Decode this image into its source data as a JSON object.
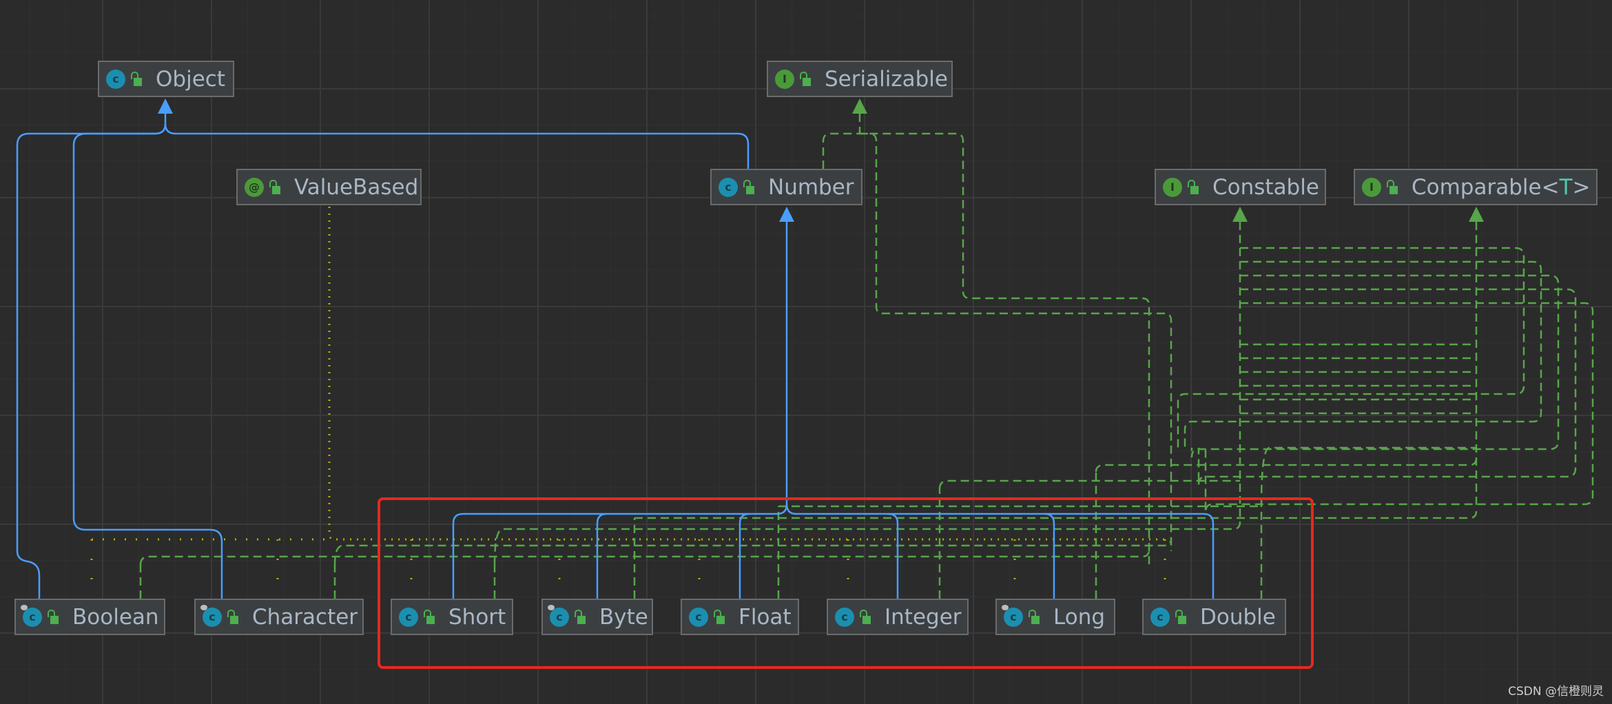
{
  "colors": {
    "extends": "#4a9eff",
    "implements": "#57a64a",
    "annotation": "#b8b000",
    "highlight": "#e8281d"
  },
  "nodes": [
    {
      "id": "object",
      "label": "Object",
      "kind": "class",
      "icon": "class-icon"
    },
    {
      "id": "serializable",
      "label": "Serializable",
      "kind": "interface",
      "icon": "interface-icon"
    },
    {
      "id": "valuebased",
      "label": "ValueBased",
      "kind": "annotation",
      "icon": "annotation-icon"
    },
    {
      "id": "number",
      "label": "Number",
      "kind": "class",
      "icon": "class-icon"
    },
    {
      "id": "constable",
      "label": "Constable",
      "kind": "interface",
      "icon": "interface-icon"
    },
    {
      "id": "comparable",
      "label": "Comparable<",
      "type_param": "T",
      "label_end": ">",
      "kind": "interface",
      "icon": "interface-icon"
    },
    {
      "id": "boolean",
      "label": "Boolean",
      "kind": "final-class",
      "icon": "final-class-icon"
    },
    {
      "id": "character",
      "label": "Character",
      "kind": "final-class",
      "icon": "final-class-icon"
    },
    {
      "id": "short",
      "label": "Short",
      "kind": "class",
      "icon": "class-icon"
    },
    {
      "id": "byte",
      "label": "Byte",
      "kind": "final-class",
      "icon": "final-class-icon"
    },
    {
      "id": "float",
      "label": "Float",
      "kind": "class",
      "icon": "class-icon"
    },
    {
      "id": "integer",
      "label": "Integer",
      "kind": "class",
      "icon": "class-icon"
    },
    {
      "id": "long",
      "label": "Long",
      "kind": "final-class",
      "icon": "final-class-icon"
    },
    {
      "id": "double",
      "label": "Double",
      "kind": "class",
      "icon": "class-icon"
    }
  ],
  "watermark": "CSDN @信橙则灵"
}
